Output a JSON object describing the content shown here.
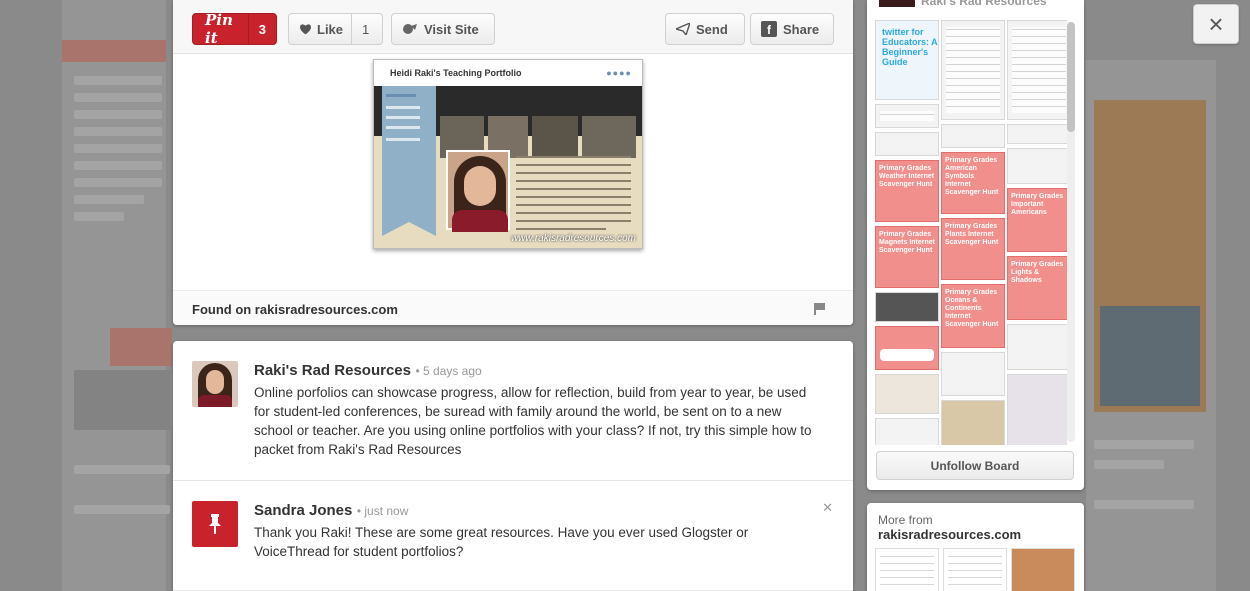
{
  "toolbar": {
    "pinit_label": "Pin it",
    "pinit_count": "3",
    "like_label": "Like",
    "like_count": "1",
    "visit_label": "Visit Site",
    "send_label": "Send",
    "share_label": "Share"
  },
  "pin": {
    "image_title": "Heidi Raki's Teaching Portfolio",
    "image_watermark": "www.rakisradresources.com",
    "found_on": "Found on rakisradresources.com"
  },
  "comments": [
    {
      "name": "Raki's Rad Resources",
      "time": "• 5 days ago",
      "text": "Online porfolios can showcase progress, allow for reflection, build from year to year, be used for student-led conferences, be suread with family around the world, be sent on to a new school or teacher. Are you using online portfolios with your class? If not, try this simple how to packet from Raki's Rad Resources"
    },
    {
      "name": "Sandra Jones",
      "time": "• just now",
      "text": "Thank you Raki! These are some great resources. Have you ever used Glogster or VoiceThread for student portfolios?"
    }
  ],
  "board": {
    "title": "Raki's Rad Resources",
    "unfollow_label": "Unfollow Board",
    "tiles": [
      "twitter for Educators: A Beginner's Guide",
      "Primary Grades Weather Internet Scavenger Hunt",
      "Primary Grades American Symbols Internet Scavenger Hunt",
      "Primary Grades Magnets Internet Scavenger Hunt",
      "Primary Grades Plants Internet Scavenger Hunt",
      "Primary Grades Important Americans",
      "Primary Grades Lights & Shadows",
      "Primary Grades Oceans & Continents Internet Scavenger Hunt"
    ]
  },
  "more_from": {
    "label": "More from",
    "source": "rakisradresources.com"
  },
  "close_label": "×",
  "colors": {
    "pinterest_red": "#c8232c",
    "overlay": "#7d7d7d",
    "tile_red": "#f08f8c"
  }
}
